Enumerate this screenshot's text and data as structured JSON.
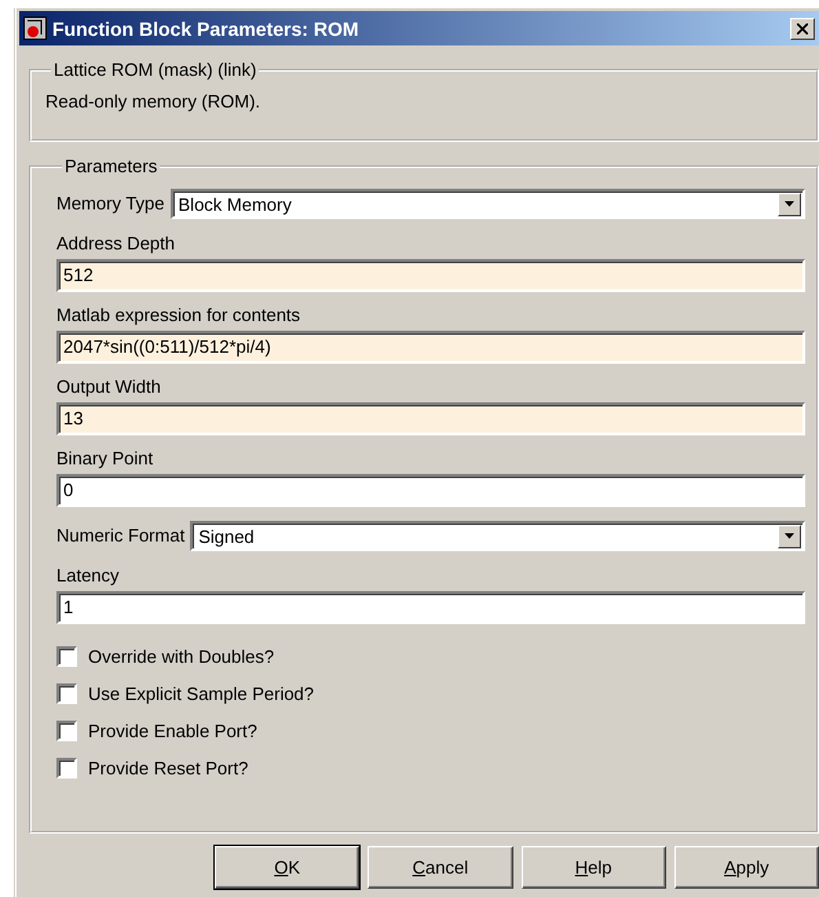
{
  "window": {
    "title": "Function Block Parameters: ROM"
  },
  "mask_group": {
    "title": "Lattice ROM (mask) (link)",
    "description": "Read-only memory (ROM)."
  },
  "parameters": {
    "title": "Parameters",
    "items": [
      {
        "kind": "dropdown",
        "label": "Memory Type",
        "value": "Block Memory"
      },
      {
        "kind": "text",
        "label": "Address Depth",
        "value": "512",
        "highlighted": true
      },
      {
        "kind": "text",
        "label": "Matlab expression for contents",
        "value": "2047*sin((0:511)/512*pi/4)",
        "highlighted": true
      },
      {
        "kind": "text",
        "label": "Output Width",
        "value": "13",
        "highlighted": true
      },
      {
        "kind": "text",
        "label": "Binary Point",
        "value": "0",
        "highlighted": false
      },
      {
        "kind": "dropdown",
        "label": "Numeric Format",
        "value": "Signed"
      },
      {
        "kind": "text",
        "label": "Latency",
        "value": "1",
        "highlighted": false
      },
      {
        "kind": "checkbox",
        "label": "Override with Doubles?",
        "checked": false
      },
      {
        "kind": "checkbox",
        "label": "Use Explicit Sample Period?",
        "checked": false
      },
      {
        "kind": "checkbox",
        "label": "Provide Enable Port?",
        "checked": false
      },
      {
        "kind": "checkbox",
        "label": "Provide Reset Port?",
        "checked": false
      }
    ]
  },
  "buttons": [
    {
      "label": "OK",
      "default": true
    },
    {
      "label": "Cancel",
      "default": false
    },
    {
      "label": "Help",
      "default": false
    },
    {
      "label": "Apply",
      "default": false
    }
  ]
}
